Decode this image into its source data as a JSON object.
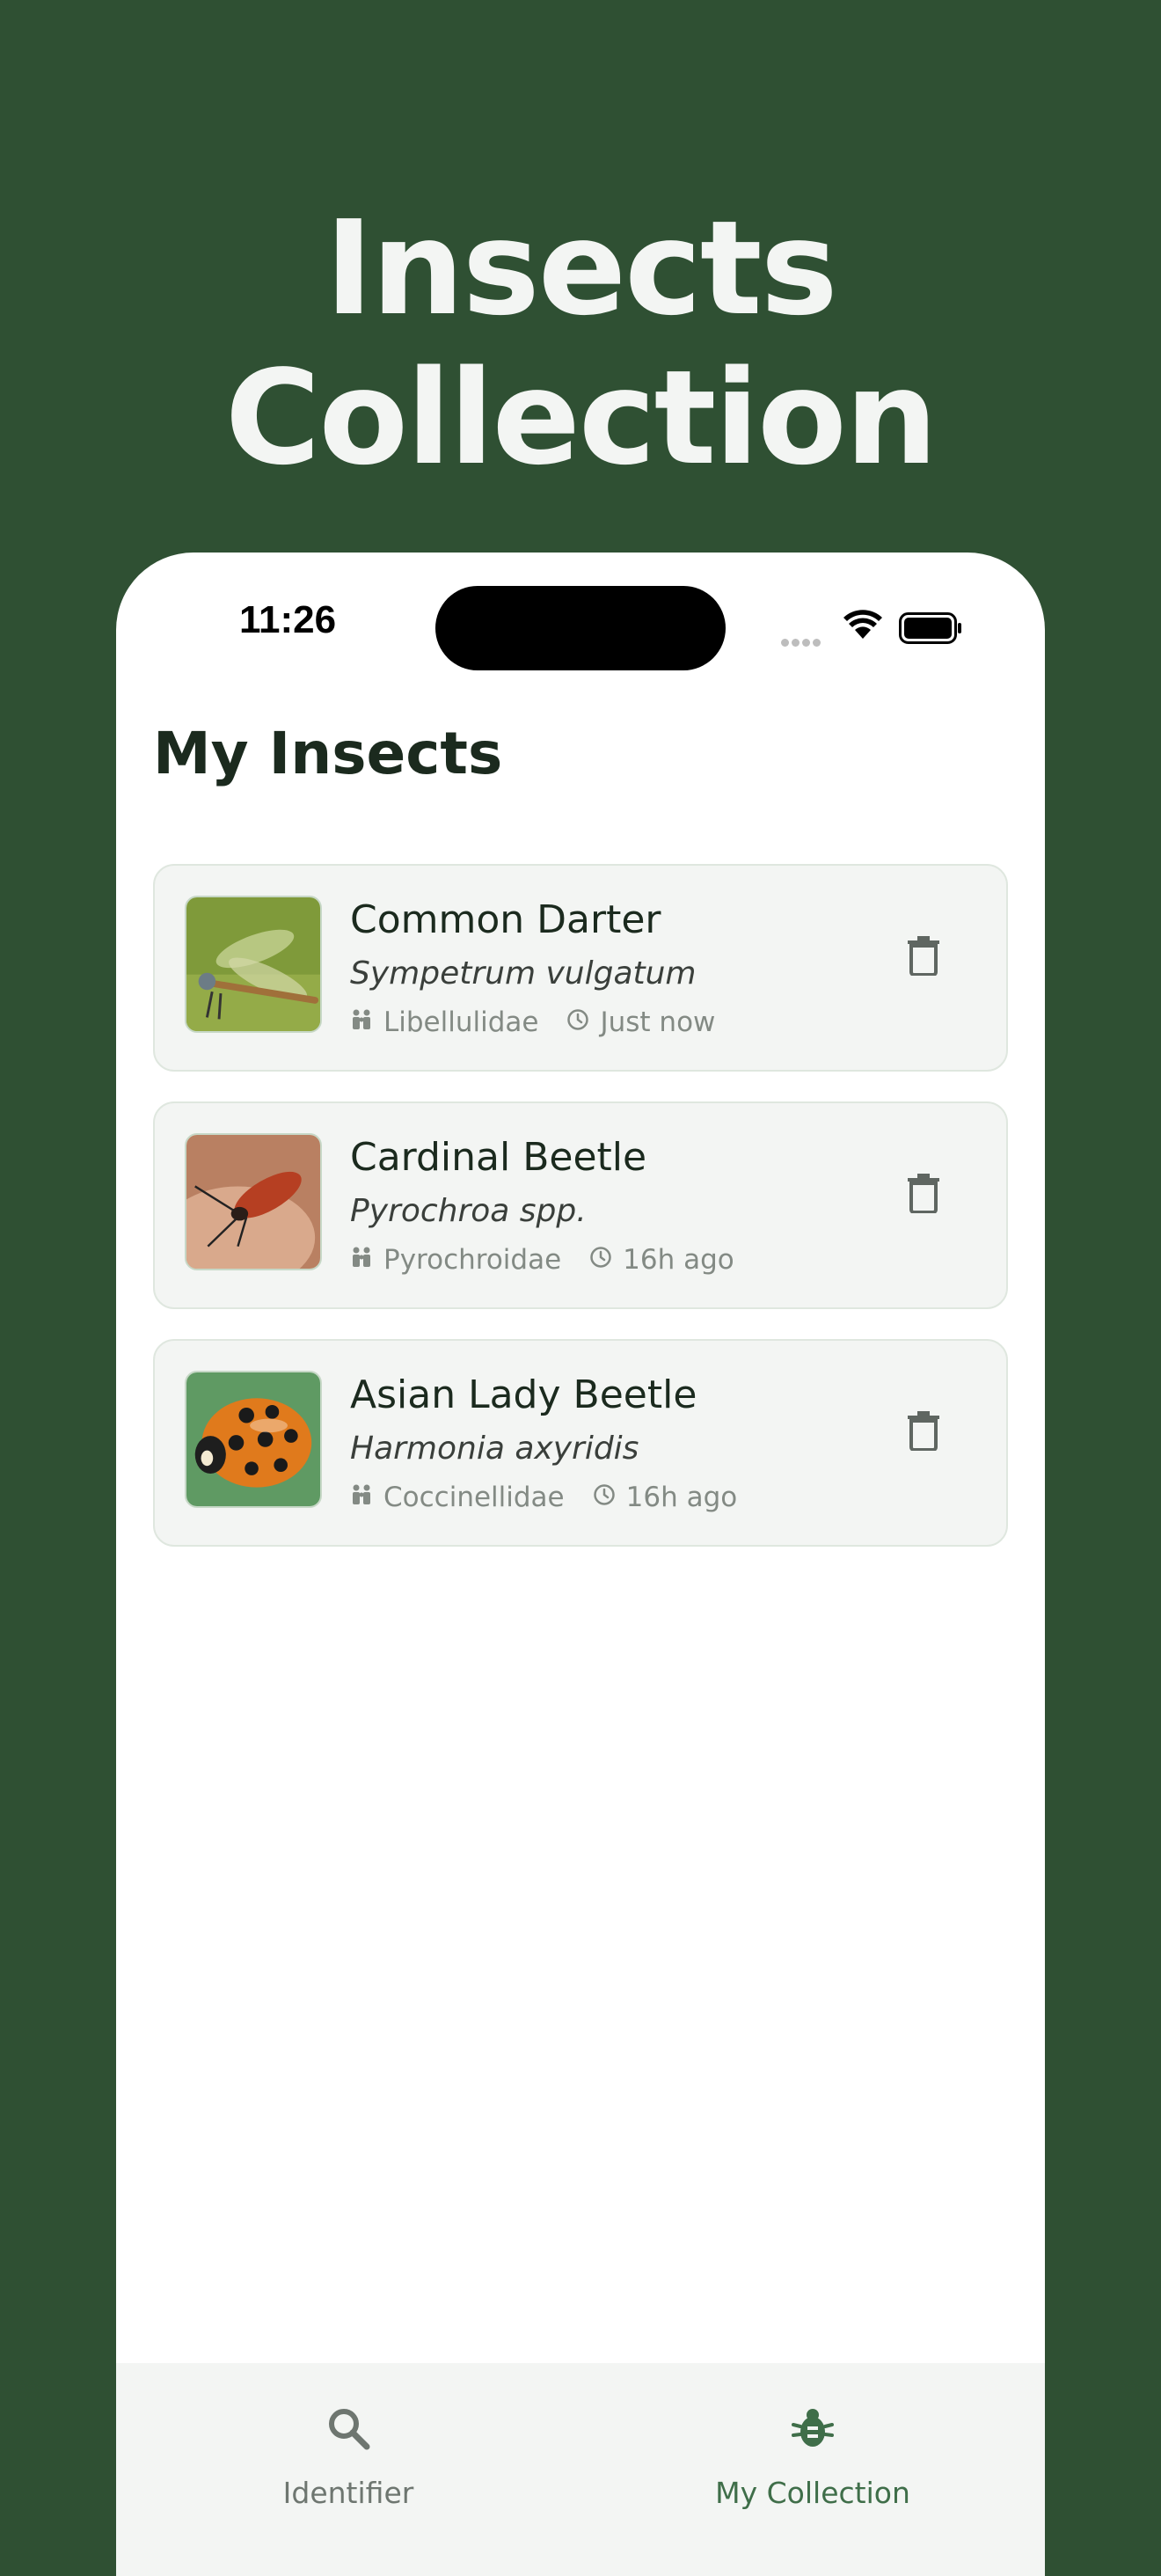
{
  "promo": {
    "title": "Insects Collection"
  },
  "status_bar": {
    "time": "11:26",
    "icons": [
      "signal-icon",
      "wifi-icon",
      "battery-icon"
    ]
  },
  "page": {
    "title": "My Insects"
  },
  "insects": [
    {
      "name": "Common Darter",
      "scientific": "Sympetrum vulgatum",
      "family": "Libellulidae",
      "time": "Just now",
      "image": "dragonfly-photo"
    },
    {
      "name": "Cardinal Beetle",
      "scientific": "Pyrochroa spp.",
      "family": "Pyrochroidae",
      "time": "16h ago",
      "image": "red-beetle-photo"
    },
    {
      "name": "Asian Lady Beetle",
      "scientific": "Harmonia axyridis",
      "family": "Coccinellidae",
      "time": "16h ago",
      "image": "ladybug-photo"
    }
  ],
  "tabs": [
    {
      "label": "Identifier",
      "icon": "search-icon",
      "active": false
    },
    {
      "label": "My Collection",
      "icon": "bug-icon",
      "active": true
    }
  ],
  "colors": {
    "background": "#2f5033",
    "card": "#f3f5f3",
    "accent": "#3f6e49",
    "text": "#1b2a1e"
  }
}
